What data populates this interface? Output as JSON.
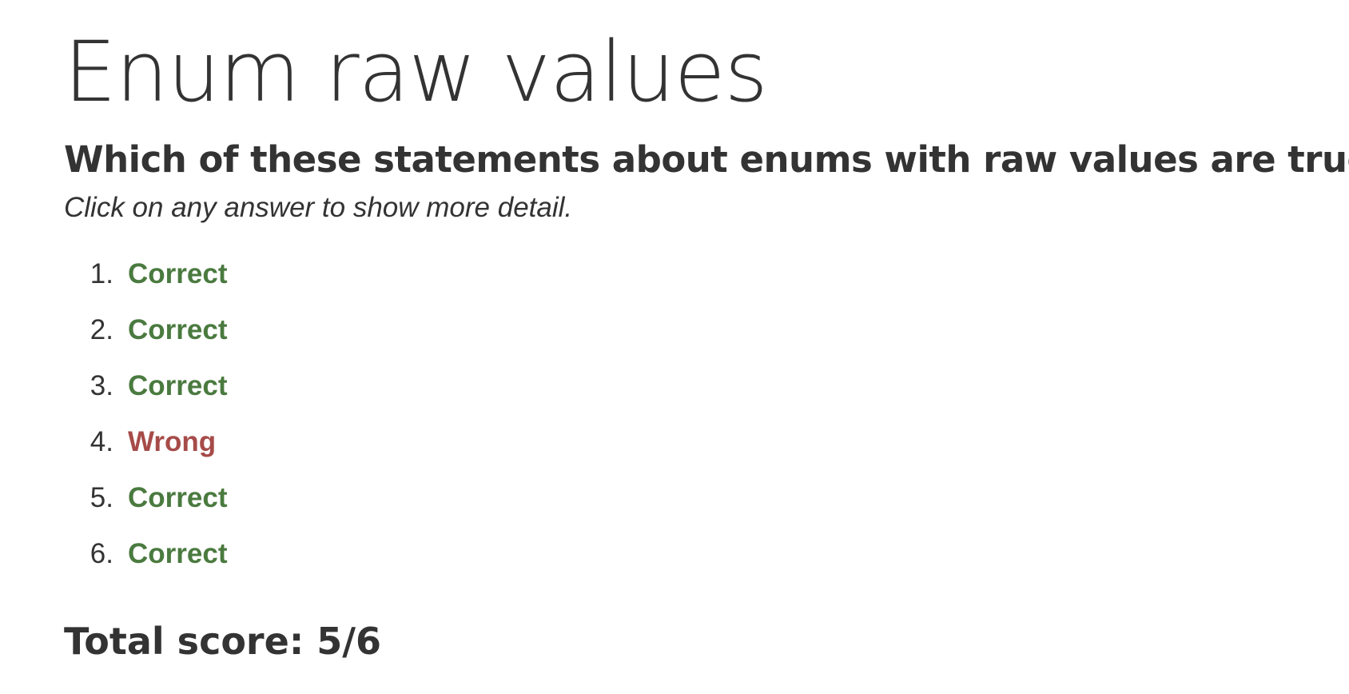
{
  "page_title": "Enum raw values",
  "question": "Which of these statements about enums with raw values are true?",
  "instructions": "Click on any answer to show more detail.",
  "colors": {
    "correct": "#4a7a3f",
    "wrong": "#a64b49",
    "text": "#333333"
  },
  "answers": [
    {
      "number": "1.",
      "result": "Correct",
      "status": "correct"
    },
    {
      "number": "2.",
      "result": "Correct",
      "status": "correct"
    },
    {
      "number": "3.",
      "result": "Correct",
      "status": "correct"
    },
    {
      "number": "4.",
      "result": "Wrong",
      "status": "wrong"
    },
    {
      "number": "5.",
      "result": "Correct",
      "status": "correct"
    },
    {
      "number": "6.",
      "result": "Correct",
      "status": "correct"
    }
  ],
  "total_score": "Total score: 5/6"
}
